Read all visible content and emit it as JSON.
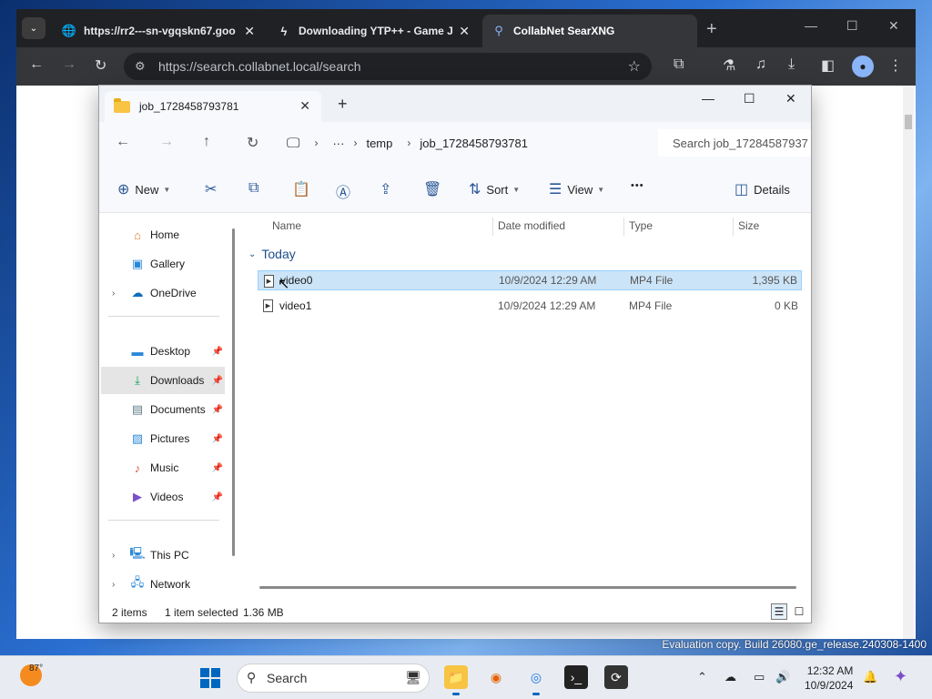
{
  "browser": {
    "tabs": [
      {
        "title": "https://rr2---sn-vgqskn67.goo",
        "icon": "globe-icon"
      },
      {
        "title": "Downloading YTP++ - Game J",
        "icon": "bolt-icon"
      },
      {
        "title": "CollabNet SearXNG",
        "icon": "search-icon"
      }
    ],
    "url": "https://search.collabnet.local/search"
  },
  "explorer": {
    "tab_title": "job_1728458793781",
    "breadcrumb": [
      "temp",
      "job_1728458793781"
    ],
    "search_placeholder": "Search job_17284587937",
    "commands": {
      "new": "New",
      "sort": "Sort",
      "view": "View",
      "more": "•••",
      "details": "Details"
    },
    "nav": {
      "home": "Home",
      "gallery": "Gallery",
      "onedrive": "OneDrive",
      "desktop": "Desktop",
      "downloads": "Downloads",
      "documents": "Documents",
      "pictures": "Pictures",
      "music": "Music",
      "videos": "Videos",
      "thispc": "This PC",
      "network": "Network"
    },
    "columns": {
      "name": "Name",
      "date": "Date modified",
      "type": "Type",
      "size": "Size"
    },
    "group": "Today",
    "files": [
      {
        "name": "video0",
        "date": "10/9/2024 12:29 AM",
        "type": "MP4 File",
        "size": "1,395 KB"
      },
      {
        "name": "video1",
        "date": "10/9/2024 12:29 AM",
        "type": "MP4 File",
        "size": "0 KB"
      }
    ],
    "status": {
      "items": "2 items",
      "selected": "1 item selected",
      "size": "1.36 MB"
    }
  },
  "desktop": {
    "evaluation_text": "Evaluation copy. Build 26080.ge_release.240308-1400"
  },
  "taskbar": {
    "temperature": "87°",
    "search_label": "Search",
    "time": "12:32 AM",
    "date": "10/9/2024"
  }
}
